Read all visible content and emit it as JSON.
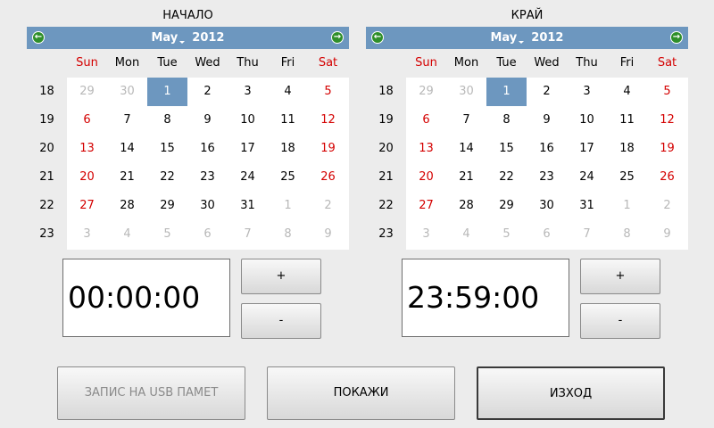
{
  "start": {
    "title": "НАЧАЛО",
    "calendar": {
      "month": "May",
      "year": "2012",
      "weekdays": [
        "Sun",
        "Mon",
        "Tue",
        "Wed",
        "Thu",
        "Fri",
        "Sat"
      ],
      "weeks": [
        "18",
        "19",
        "20",
        "21",
        "22",
        "23"
      ],
      "days": [
        [
          "29",
          "30",
          "1",
          "2",
          "3",
          "4",
          "5"
        ],
        [
          "6",
          "7",
          "8",
          "9",
          "10",
          "11",
          "12"
        ],
        [
          "13",
          "14",
          "15",
          "16",
          "17",
          "18",
          "19"
        ],
        [
          "20",
          "21",
          "22",
          "23",
          "24",
          "25",
          "26"
        ],
        [
          "27",
          "28",
          "29",
          "30",
          "31",
          "1",
          "2"
        ],
        [
          "3",
          "4",
          "5",
          "6",
          "7",
          "8",
          "9"
        ]
      ],
      "selected_day": "1"
    },
    "time": "00:00:00",
    "plus_label": "+",
    "minus_label": "-"
  },
  "end": {
    "title": "КРАЙ",
    "calendar": {
      "month": "May",
      "year": "2012",
      "weekdays": [
        "Sun",
        "Mon",
        "Tue",
        "Wed",
        "Thu",
        "Fri",
        "Sat"
      ],
      "weeks": [
        "18",
        "19",
        "20",
        "21",
        "22",
        "23"
      ],
      "days": [
        [
          "29",
          "30",
          "1",
          "2",
          "3",
          "4",
          "5"
        ],
        [
          "6",
          "7",
          "8",
          "9",
          "10",
          "11",
          "12"
        ],
        [
          "13",
          "14",
          "15",
          "16",
          "17",
          "18",
          "19"
        ],
        [
          "20",
          "21",
          "22",
          "23",
          "24",
          "25",
          "26"
        ],
        [
          "27",
          "28",
          "29",
          "30",
          "31",
          "1",
          "2"
        ],
        [
          "3",
          "4",
          "5",
          "6",
          "7",
          "8",
          "9"
        ]
      ],
      "selected_day": "1"
    },
    "time": "23:59:00",
    "plus_label": "+",
    "minus_label": "-"
  },
  "actions": {
    "usb_label": "ЗАПИС НА USB ПАМЕТ",
    "show_label": "ПОКАЖИ",
    "exit_label": "ИЗХОД"
  },
  "colors": {
    "header": "#6d97bf",
    "weekend": "#d40000",
    "other_month": "#b8b8b8"
  },
  "icons": {
    "prev": "arrow-left-icon",
    "next": "arrow-right-icon"
  }
}
